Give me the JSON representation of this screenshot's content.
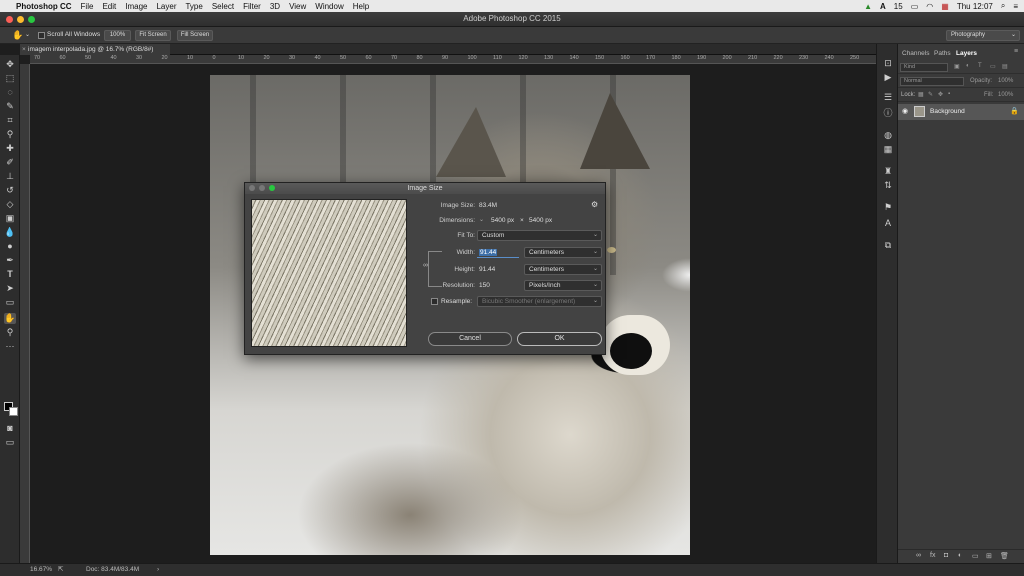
{
  "menubar": {
    "apple": "",
    "app": "Photoshop CC",
    "items": [
      "File",
      "Edit",
      "Image",
      "Layer",
      "Type",
      "Select",
      "Filter",
      "3D",
      "View",
      "Window",
      "Help"
    ],
    "clock": "Thu 12:07",
    "badge": "15"
  },
  "window": {
    "title": "Adobe Photoshop CC 2015"
  },
  "options": {
    "scroll_all": "Scroll All Windows",
    "zoom100": "100%",
    "fit_screen": "Fit Screen",
    "fill_screen": "Fill Screen",
    "workspace": "Photography"
  },
  "document": {
    "tab": "imagem interpolada.jpg @ 16.7% (RGB/8#)"
  },
  "ruler": [
    "70",
    "60",
    "50",
    "40",
    "30",
    "20",
    "10",
    "0",
    "10",
    "20",
    "30",
    "40",
    "50",
    "60",
    "70",
    "80",
    "90",
    "100",
    "110",
    "120",
    "130",
    "140",
    "150",
    "160",
    "170",
    "180",
    "190",
    "200",
    "210",
    "220",
    "230",
    "240",
    "250"
  ],
  "dialog": {
    "title": "Image Size",
    "image_size_label": "Image Size:",
    "image_size_value": "83.4M",
    "dimensions_label": "Dimensions:",
    "dim_w": "5400 px",
    "dim_x": "×",
    "dim_h": "5400 px",
    "fit_to_label": "Fit To:",
    "fit_to_value": "Custom",
    "width_label": "Width:",
    "width_value": "91.44",
    "width_unit": "Centimeters",
    "height_label": "Height:",
    "height_value": "91.44",
    "height_unit": "Centimeters",
    "resolution_label": "Resolution:",
    "resolution_value": "150",
    "resolution_unit": "Pixels/Inch",
    "resample_label": "Resample:",
    "resample_value": "Bicubic Smoother (enlargement)",
    "cancel": "Cancel",
    "ok": "OK"
  },
  "panel": {
    "tabs": [
      "Channels",
      "Paths",
      "Layers"
    ],
    "kind": "Kind",
    "blend": "Normal",
    "opacity_label": "Opacity:",
    "opacity_value": "100%",
    "lock_label": "Lock:",
    "fill_label": "Fill:",
    "fill_value": "100%",
    "layer_name": "Background"
  },
  "status": {
    "zoom": "16.67%",
    "doc": "Doc: 83.4M/83.4M"
  }
}
